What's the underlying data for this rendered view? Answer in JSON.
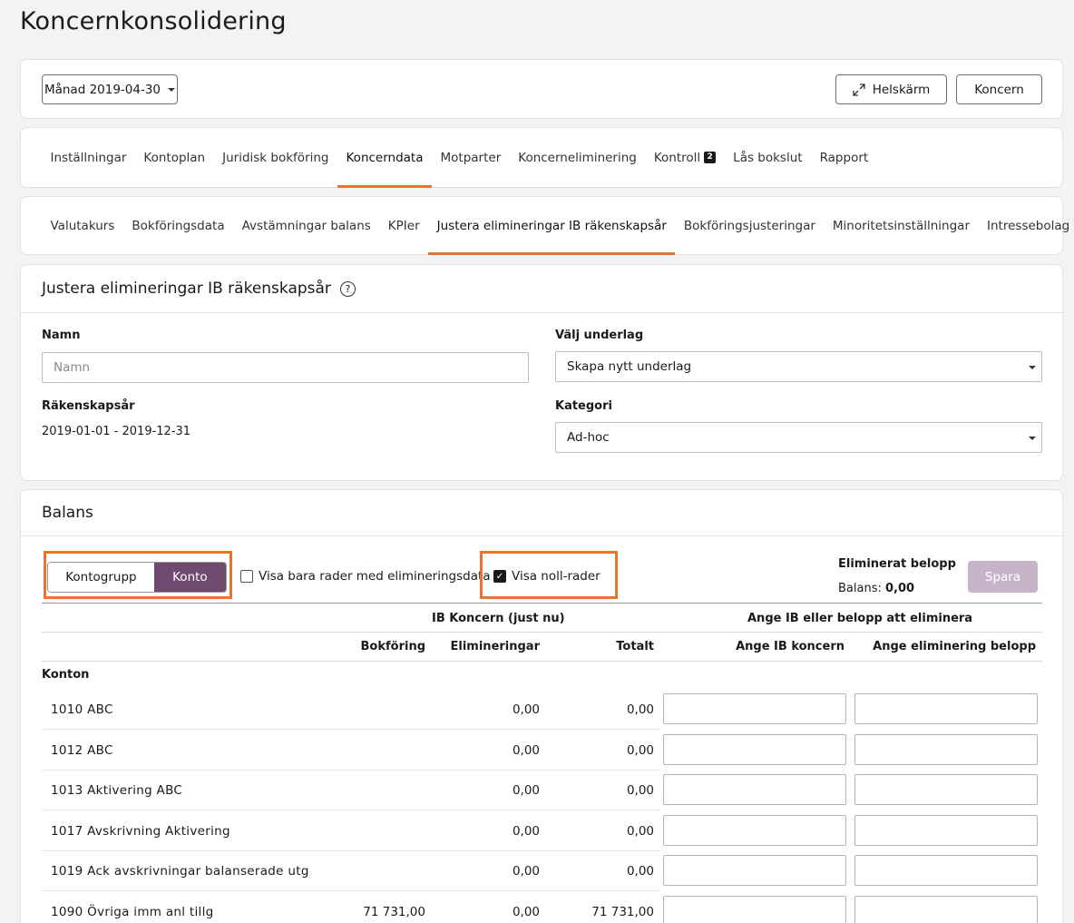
{
  "page": {
    "title": "Koncernkonsolidering"
  },
  "toolbar": {
    "period_label": "Månad 2019-04-30",
    "fullscreen_label": "Helskärm",
    "group_label": "Koncern"
  },
  "main_tabs": [
    {
      "label": "Inställningar"
    },
    {
      "label": "Kontoplan"
    },
    {
      "label": "Juridisk bokföring"
    },
    {
      "label": "Koncerndata",
      "active": true
    },
    {
      "label": "Motparter"
    },
    {
      "label": "Koncerneliminering"
    },
    {
      "label": "Kontroll",
      "badge": "2"
    },
    {
      "label": "Lås bokslut"
    },
    {
      "label": "Rapport"
    }
  ],
  "sub_tabs": [
    {
      "label": "Valutakurs"
    },
    {
      "label": "Bokföringsdata"
    },
    {
      "label": "Avstämningar balans"
    },
    {
      "label": "KPIer"
    },
    {
      "label": "Justera elimineringar IB räkenskapsår",
      "active": true
    },
    {
      "label": "Bokföringsjusteringar"
    },
    {
      "label": "Minoritetsinställningar"
    },
    {
      "label": "Intressebolag"
    }
  ],
  "form": {
    "title": "Justera elimineringar IB räkenskapsår",
    "help_icon": "?",
    "name_label": "Namn",
    "name_placeholder": "Namn",
    "fiscal_year_label": "Räkenskapsår",
    "fiscal_year_value": "2019-01-01 - 2019-12-31",
    "basis_label": "Välj underlag",
    "basis_value": "Skapa nytt underlag",
    "category_label": "Kategori",
    "category_value": "Ad-hoc"
  },
  "balance": {
    "title": "Balans",
    "toggle_group": "Kontogrupp",
    "toggle_account": "Konto",
    "only_elim_label": "Visa bara rader med elimineringsdata",
    "show_zero_label": "Visa noll-rader",
    "eliminated_label": "Eliminerat belopp",
    "balance_label": "Balans:",
    "balance_value": "0,00",
    "save_label": "Spara",
    "group_header_ib": "IB Koncern (just nu)",
    "group_header_enter": "Ange IB eller belopp att eliminera",
    "col_booking": "Bokföring",
    "col_elim": "Elimineringar",
    "col_total": "Totalt",
    "col_enter_ib": "Ange IB koncern",
    "col_enter_elim": "Ange eliminering belopp",
    "section_label": "Konton",
    "rows": [
      {
        "account": "1010 ABC",
        "booking": "",
        "elim": "0,00",
        "total": "0,00"
      },
      {
        "account": "1012 ABC",
        "booking": "",
        "elim": "0,00",
        "total": "0,00"
      },
      {
        "account": "1013 Aktivering ABC",
        "booking": "",
        "elim": "0,00",
        "total": "0,00"
      },
      {
        "account": "1017 Avskrivning Aktivering",
        "booking": "",
        "elim": "0,00",
        "total": "0,00"
      },
      {
        "account": "1019 Ack avskrivningar balanserade utg",
        "booking": "",
        "elim": "0,00",
        "total": "0,00"
      },
      {
        "account": "1090 Övriga imm anl tillg",
        "booking": "71 731,00",
        "elim": "0,00",
        "total": "71 731,00"
      }
    ]
  },
  "colors": {
    "accent": "#e9742b",
    "toggle_active": "#6f4a6e",
    "save_disabled": "#c8b4c8"
  }
}
